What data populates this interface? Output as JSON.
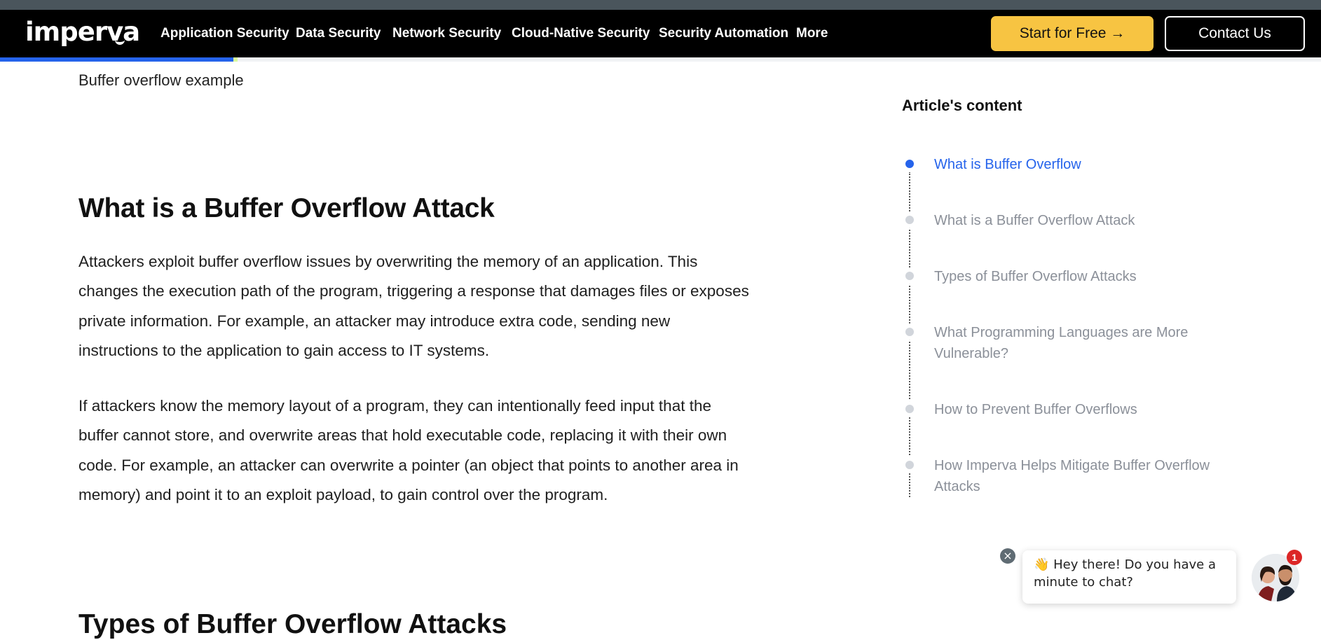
{
  "brand": {
    "logo_text": "imperva"
  },
  "nav": {
    "items": [
      {
        "label": "Application Security"
      },
      {
        "label": "Data Security"
      },
      {
        "label": "Network Security"
      },
      {
        "label": "Cloud-Native Security"
      },
      {
        "label": "Security Automation"
      },
      {
        "label": "More"
      }
    ],
    "start_free_label": "Start for Free →",
    "contact_label": "Contact Us"
  },
  "reading_progress": {
    "percent": 18,
    "accent": "#2563eb"
  },
  "article": {
    "breadcrumb": "Buffer overflow example",
    "section_title": "What is a Buffer Overflow Attack",
    "paragraphs": [
      "Attackers exploit buffer overflow issues by overwriting the memory of an application. This changes the execution path of the program, triggering a response that damages files or exposes private information. For example, an attacker may introduce extra code, sending new instructions to the application to gain access to IT systems.",
      "If attackers know the memory layout of a program, they can intentionally feed input that the buffer cannot store, and overwrite areas that hold executable code, replacing it with their own code. For example, an attacker can overwrite a pointer (an object that points to another area in memory) and point it to an exploit payload, to gain control over the program."
    ],
    "next_heading": "Types of Buffer Overflow Attacks"
  },
  "toc": {
    "title": "Article's content",
    "items": [
      {
        "label": "What is Buffer Overflow",
        "active": true
      },
      {
        "label": "What is a Buffer Overflow Attack",
        "active": false
      },
      {
        "label": "Types of Buffer Overflow Attacks",
        "active": false
      },
      {
        "label": "What Programming Languages are More Vulnerable?",
        "active": false
      },
      {
        "label": "How to Prevent Buffer Overflows",
        "active": false
      },
      {
        "label": "How Imperva Helps Mitigate Buffer Overflow Attacks",
        "active": false
      }
    ]
  },
  "chat": {
    "message": "👋 Hey there! Do you have a minute to chat?",
    "badge_count": "1",
    "close_icon": "close-icon"
  }
}
